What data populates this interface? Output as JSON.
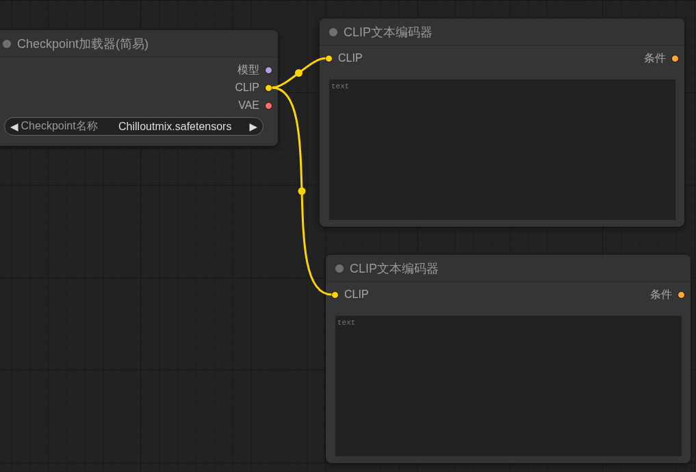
{
  "nodes": [
    {
      "title": "Checkpoint加载器(简易)",
      "outputs": [
        {
          "label": "模型",
          "color": "#b39ddb"
        },
        {
          "label": "CLIP",
          "color": "#ffd500"
        },
        {
          "label": "VAE",
          "color": "#ff6e6e"
        }
      ],
      "widgets": [
        {
          "kind": "combo",
          "label": "Checkpoint名称",
          "value": "Chilloutmix.safetensors",
          "left_arrow": "◀",
          "right_arrow": "▶"
        }
      ]
    },
    {
      "title": "CLIP文本编码器",
      "inputs": [
        {
          "label": "CLIP",
          "color": "#ffd500"
        }
      ],
      "outputs": [
        {
          "label": "条件",
          "color": "#ffa931"
        }
      ],
      "widgets": [
        {
          "kind": "textarea",
          "placeholder": "text"
        }
      ]
    },
    {
      "title": "CLIP文本编码器",
      "inputs": [
        {
          "label": "CLIP",
          "color": "#ffd500"
        }
      ],
      "outputs": [
        {
          "label": "条件",
          "color": "#ffa931"
        }
      ],
      "widgets": [
        {
          "kind": "textarea",
          "placeholder": "text"
        }
      ]
    }
  ]
}
